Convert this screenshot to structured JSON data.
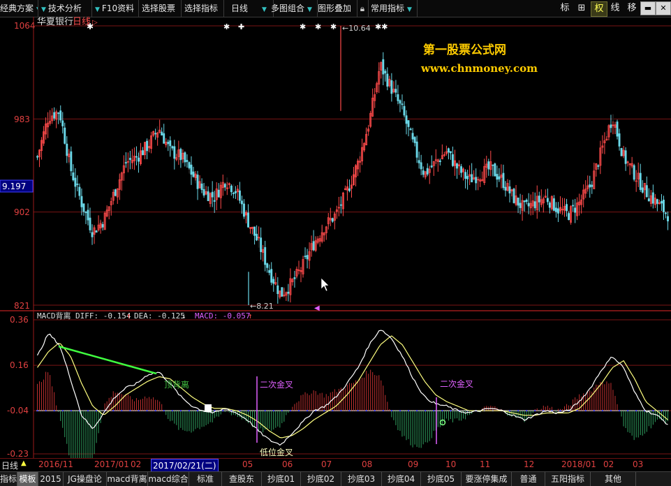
{
  "toolbar": {
    "items": [
      "经典方案",
      "技术分析",
      "F10资料",
      "选择股票",
      "选择指标",
      "日线",
      "多图组合",
      "图形叠加",
      "常用指标"
    ],
    "right_buttons": [
      "标",
      "⊞",
      "权",
      "线",
      "移"
    ],
    "active_right": "权"
  },
  "stock": {
    "name": "华夏银行",
    "period": "日线"
  },
  "price_axis": {
    "ticks": [
      "1064",
      "983",
      "902",
      "821"
    ],
    "current": "9.197"
  },
  "price_annotations": {
    "high": "10.64",
    "low": "8.21"
  },
  "watermark": {
    "title": "第一股票公式网",
    "url": "www.chnmoney.com"
  },
  "macd_header": {
    "name": "MACD背离",
    "diff": "DIFF: -0.154",
    "dea": "DEA: -0.125",
    "macd": "MACD: -0.057"
  },
  "macd_axis": {
    "ticks": [
      "0.36",
      "0.16",
      "-0.04",
      "-0.23"
    ]
  },
  "macd_labels": {
    "top_divergence": "顶背离",
    "second_cross_1": "二次金叉",
    "low_cross": "低位金叉",
    "second_cross_2": "二次金叉"
  },
  "date_axis": {
    "period": "日线",
    "labels": [
      "2016/11",
      "2017/01",
      "02",
      "2017/02/21(二)",
      "05",
      "06",
      "07",
      "08",
      "09",
      "10",
      "11",
      "12",
      "2018/01",
      "02",
      "03"
    ]
  },
  "tabs": [
    "指标",
    "模板",
    "2015",
    "JG操盘论",
    "macd背离",
    "macd综合",
    "标准",
    "查股东",
    "抄底01",
    "抄底02",
    "抄底03",
    "抄底04",
    "抄底05",
    "要涨停集成",
    "普通",
    "五阳指标",
    "其他"
  ],
  "active_tab": "模板",
  "colors": {
    "up": "#ff4a4a",
    "down": "#6ad8e8",
    "grid": "#7a1515",
    "diff": "#ffffff",
    "dea": "#ffff80",
    "trendline": "#40ff40",
    "watermark": "#ffcc00",
    "macd_purple": "#e060ff"
  },
  "chart_data": {
    "type": "candlestick+macd",
    "price_range": [
      8.21,
      10.64
    ],
    "price_ticks": [
      10.64,
      9.83,
      9.02,
      8.21
    ],
    "close_path": [
      9.5,
      9.85,
      9.9,
      9.4,
      9.1,
      8.85,
      8.95,
      9.2,
      9.45,
      9.5,
      9.6,
      9.75,
      9.55,
      9.5,
      9.35,
      9.2,
      9.15,
      9.3,
      9.2,
      8.95,
      8.75,
      8.5,
      8.3,
      8.4,
      8.55,
      8.75,
      8.9,
      9.0,
      9.2,
      9.45,
      9.8,
      10.3,
      10.1,
      9.9,
      9.6,
      9.35,
      9.45,
      9.55,
      9.4,
      9.3,
      9.35,
      9.4,
      9.3,
      9.15,
      9.05,
      9.1,
      9.15,
      9.05,
      9.0,
      9.1,
      9.25,
      9.55,
      9.85,
      9.5,
      9.35,
      9.2,
      9.1,
      9.0
    ],
    "macd_range": [
      -0.23,
      0.36
    ],
    "macd_ticks": [
      0.36,
      0.16,
      -0.04,
      -0.23
    ],
    "diff_path": [
      0.2,
      0.3,
      0.25,
      0.1,
      -0.06,
      -0.12,
      -0.05,
      0.02,
      0.06,
      0.08,
      0.12,
      0.13,
      0.08,
      0.02,
      -0.02,
      -0.04,
      -0.05,
      -0.03,
      -0.05,
      -0.08,
      -0.13,
      -0.17,
      -0.19,
      -0.14,
      -0.09,
      -0.04,
      -0.02,
      0.02,
      0.08,
      0.15,
      0.25,
      0.32,
      0.28,
      0.2,
      0.1,
      0.02,
      -0.01,
      -0.02,
      -0.04,
      -0.05,
      -0.04,
      -0.03,
      -0.04,
      -0.06,
      -0.08,
      -0.06,
      -0.04,
      -0.05,
      -0.04,
      0.0,
      0.06,
      0.14,
      0.2,
      0.15,
      0.04,
      -0.04,
      -0.06,
      -0.1
    ],
    "dea_path": [
      0.15,
      0.22,
      0.26,
      0.2,
      0.08,
      -0.02,
      -0.06,
      -0.02,
      0.03,
      0.06,
      0.09,
      0.11,
      0.1,
      0.06,
      0.02,
      -0.01,
      -0.03,
      -0.03,
      -0.04,
      -0.06,
      -0.09,
      -0.13,
      -0.16,
      -0.15,
      -0.12,
      -0.08,
      -0.05,
      -0.02,
      0.03,
      0.09,
      0.17,
      0.25,
      0.29,
      0.25,
      0.17,
      0.09,
      0.03,
      0.0,
      -0.02,
      -0.04,
      -0.04,
      -0.04,
      -0.04,
      -0.05,
      -0.06,
      -0.06,
      -0.05,
      -0.05,
      -0.05,
      -0.03,
      0.02,
      0.08,
      0.15,
      0.18,
      0.1,
      0.0,
      -0.04,
      -0.08
    ]
  }
}
